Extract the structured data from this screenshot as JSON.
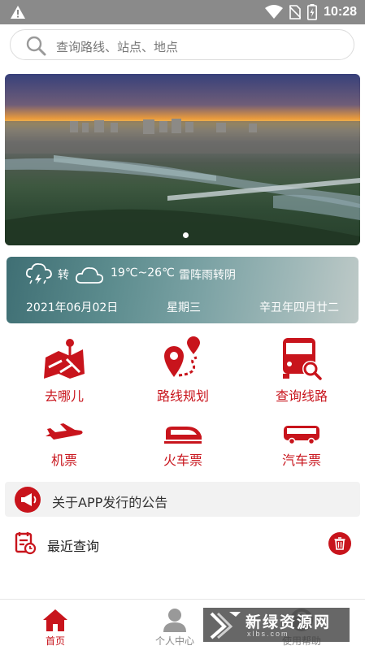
{
  "status_bar": {
    "time": "10:28",
    "icons": [
      "warning-icon",
      "wifi-icon",
      "no-sim-icon",
      "battery-charging-icon"
    ]
  },
  "search": {
    "placeholder": "查询路线、站点、地点",
    "icon": "search-icon"
  },
  "banner": {
    "slide_count": 1,
    "active_slide": 1
  },
  "weather": {
    "from_icon": "thunder-shower-icon",
    "connector": "转",
    "to_icon": "cloudy-icon",
    "temperature": "19℃~26℃",
    "description": "雷阵雨转阴",
    "date": "2021年06月02日",
    "weekday": "星期三",
    "lunar": "辛丑年四月廿二"
  },
  "menu": [
    {
      "label": "去哪儿",
      "icon": "map-pin-icon"
    },
    {
      "label": "路线规划",
      "icon": "route-icon"
    },
    {
      "label": "查询线路",
      "icon": "bus-search-icon"
    },
    {
      "label": "机票",
      "icon": "airplane-icon"
    },
    {
      "label": "火车票",
      "icon": "train-icon"
    },
    {
      "label": "汽车票",
      "icon": "coach-icon"
    }
  ],
  "notice": {
    "text": "关于APP发行的公告",
    "icon": "megaphone-icon"
  },
  "recent": {
    "title": "最近查询",
    "icon": "history-icon",
    "delete_icon": "trash-icon"
  },
  "tabs": [
    {
      "label": "首页",
      "icon": "home-icon",
      "active": true
    },
    {
      "label": "个人中心",
      "icon": "person-icon",
      "active": false
    },
    {
      "label": "使用帮助",
      "icon": "help-icon",
      "active": false
    }
  ],
  "watermark": {
    "text": "新绿资源网",
    "subtext": "xlbs.com"
  },
  "colors": {
    "brand": "#c8141c",
    "status_bar": "#8a8a8a",
    "inactive_tab": "#888888"
  }
}
